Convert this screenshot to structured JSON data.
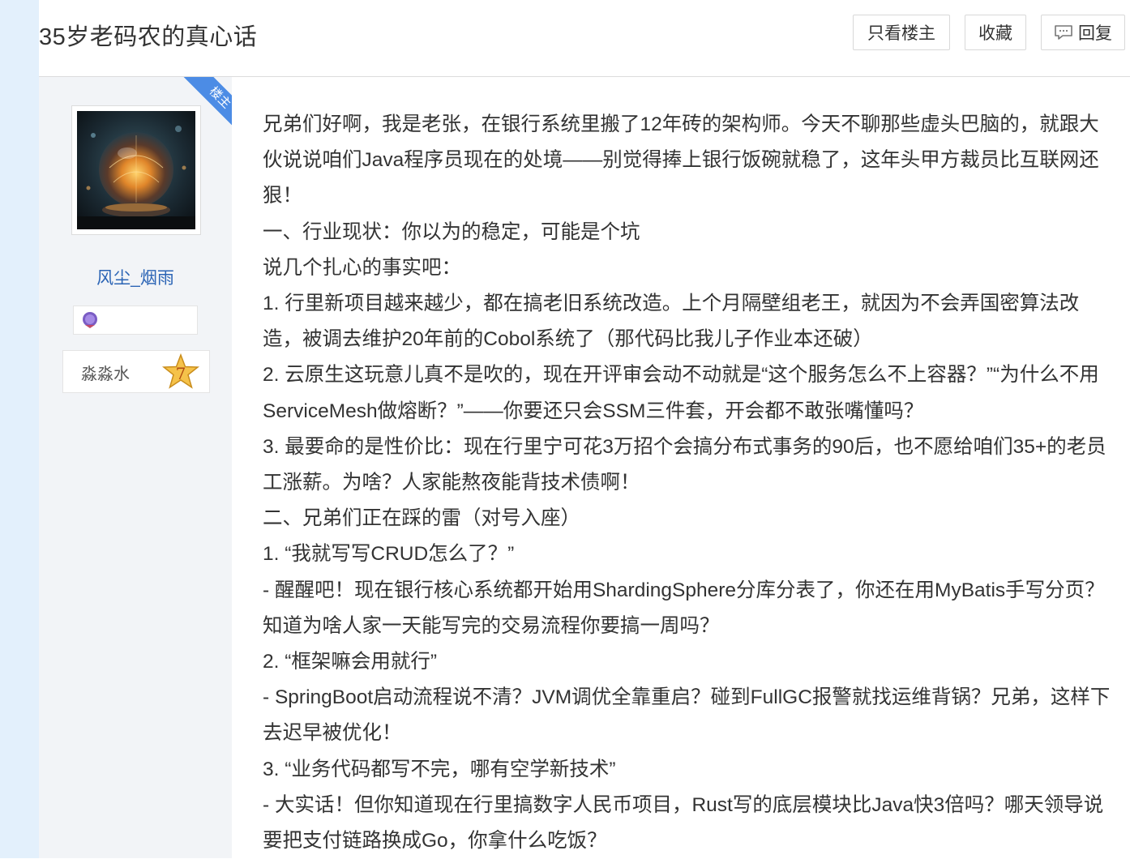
{
  "header": {
    "title": "35岁老码农的真心话",
    "buttons": {
      "only_op": "只看楼主",
      "collect": "收藏",
      "reply": "回复"
    }
  },
  "author": {
    "op_tag": "楼主",
    "username": "风尘_烟雨",
    "level_name": "淼淼水",
    "level_number": "7"
  },
  "post": {
    "paragraphs": [
      "兄弟们好啊，我是老张，在银行系统里搬了12年砖的架构师。今天不聊那些虚头巴脑的，就跟大伙说说咱们Java程序员现在的处境——别觉得捧上银行饭碗就稳了，这年头甲方裁员比互联网还狠！",
      "一、行业现状：你以为的稳定，可能是个坑",
      "说几个扎心的事实吧：",
      "1. 行里新项目越来越少，都在搞老旧系统改造。上个月隔壁组老王，就因为不会弄国密算法改造，被调去维护20年前的Cobol系统了（那代码比我儿子作业本还破）",
      "2. 云原生这玩意儿真不是吹的，现在开评审会动不动就是“这个服务怎么不上容器？”“为什么不用ServiceMesh做熔断？”——你要还只会SSM三件套，开会都不敢张嘴懂吗？",
      "3. 最要命的是性价比：现在行里宁可花3万招个会搞分布式事务的90后，也不愿给咱们35+的老员工涨薪。为啥？人家能熬夜能背技术债啊！",
      "二、兄弟们正在踩的雷（对号入座）",
      "1. “我就写写CRUD怎么了？”",
      "- 醒醒吧！现在银行核心系统都开始用ShardingSphere分库分表了，你还在用MyBatis手写分页？知道为啥人家一天能写完的交易流程你要搞一周吗？",
      "2. “框架嘛会用就行”",
      "- SpringBoot启动流程说不清？JVM调优全靠重启？碰到FullGC报警就找运维背锅？兄弟，这样下去迟早被优化！",
      "3. “业务代码都写不完，哪有空学新技术”",
      "- 大实话！但你知道现在行里搞数字人民币项目，Rust写的底层模块比Java快3倍吗？哪天领导说要把支付链路换成Go，你拿什么吃饭？"
    ]
  }
}
